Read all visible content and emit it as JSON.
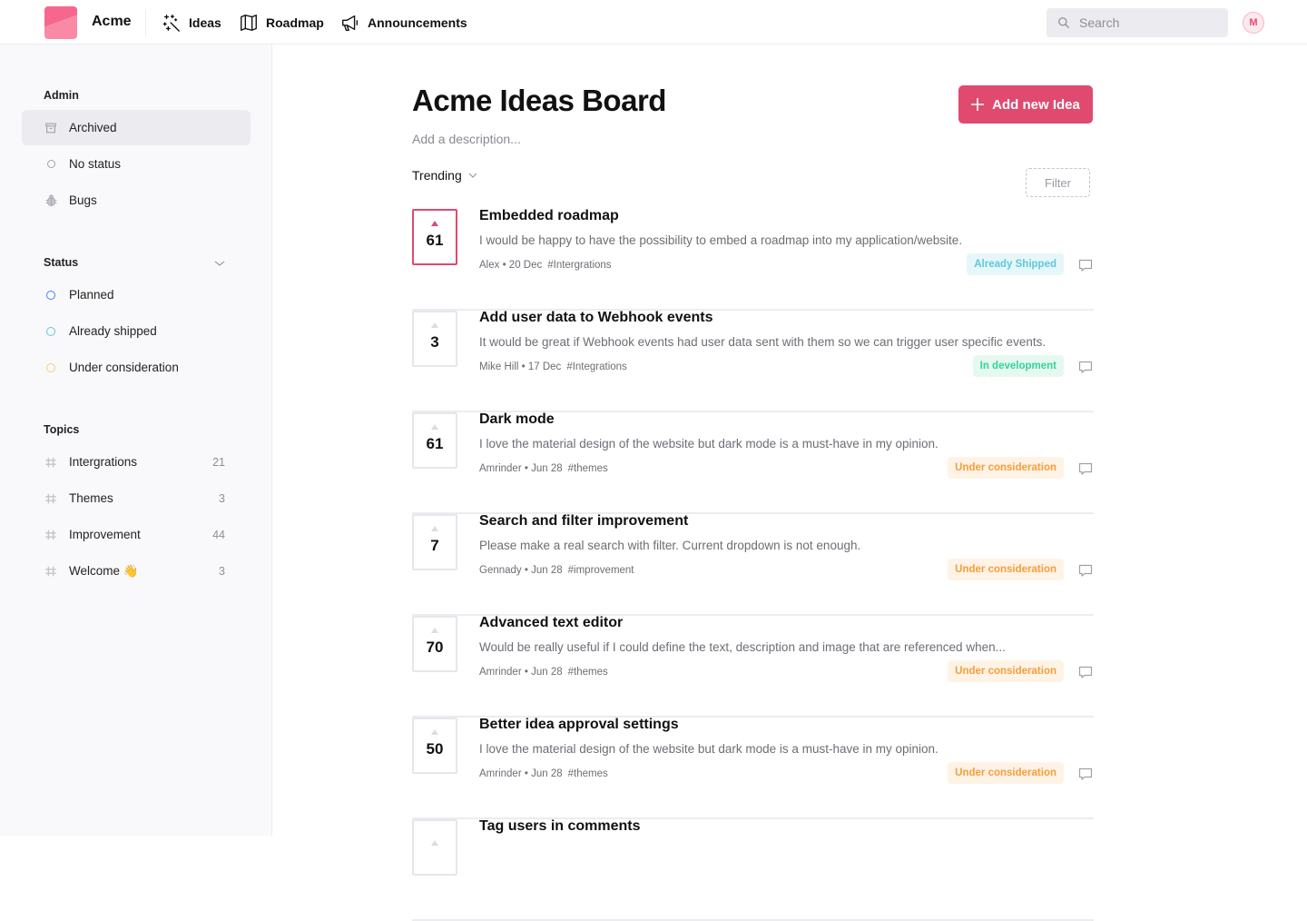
{
  "header": {
    "brand": "Acme",
    "nav": [
      {
        "label": "Ideas",
        "icon": "magic-wand-icon"
      },
      {
        "label": "Roadmap",
        "icon": "map-icon"
      },
      {
        "label": "Announcements",
        "icon": "megaphone-icon"
      }
    ],
    "search_placeholder": "Search",
    "avatar_initial": "M"
  },
  "sidebar": {
    "admin": {
      "title": "Admin",
      "items": [
        {
          "label": "Archived",
          "icon": "archive-icon",
          "active": true
        },
        {
          "label": "No status",
          "icon": "circle-icon"
        },
        {
          "label": "Bugs",
          "icon": "bug-icon"
        }
      ]
    },
    "status": {
      "title": "Status",
      "items": [
        {
          "label": "Planned",
          "color": "#3b82f6"
        },
        {
          "label": "Already shipped",
          "color": "#5ec8d8"
        },
        {
          "label": "Under consideration",
          "color": "#fbc97a"
        }
      ]
    },
    "topics": {
      "title": "Topics",
      "items": [
        {
          "label": "Intergrations",
          "count": "21"
        },
        {
          "label": "Themes",
          "count": "3"
        },
        {
          "label": "Improvement",
          "count": "44"
        },
        {
          "label": "Welcome 👋",
          "count": "3"
        }
      ]
    }
  },
  "main": {
    "title": "Acme Ideas Board",
    "description_placeholder": "Add a description...",
    "add_button": "Add new Idea",
    "sort_label": "Trending",
    "filter_label": "Filter",
    "ideas": [
      {
        "votes": "61",
        "title": "Embedded roadmap",
        "body": "I would be happy to have the possibility to embed a roadmap into my application/website.",
        "author": "Alex",
        "date": "20 Dec",
        "tag": "#Intergrations",
        "status": "Already Shipped",
        "status_color": "#5ec8d8",
        "status_bg": "#e6f7fa",
        "voted": true
      },
      {
        "votes": "3",
        "title": "Add user data to Webhook events",
        "body": "It would be great if Webhook events had user data sent with them so we can trigger user specific events.",
        "author": "Mike Hill",
        "date": "17 Dec",
        "tag": "#Integrations",
        "status": "In development",
        "status_color": "#34d399",
        "status_bg": "#e6f9f1"
      },
      {
        "votes": "61",
        "title": "Dark mode",
        "body": "I love the material design of the website but dark mode is a must-have in my opinion.",
        "author": "Amrinder",
        "date": "Jun 28",
        "tag": "#themes",
        "status": "Under consideration",
        "status_color": "#f59e3b",
        "status_bg": "#fff3e6"
      },
      {
        "votes": "7",
        "title": "Search and filter improvement",
        "body": "Please make a real search with filter.  Current dropdown is not enough.",
        "author": "Gennady",
        "date": "Jun 28",
        "tag": "#improvement",
        "status": "Under consideration",
        "status_color": "#f59e3b",
        "status_bg": "#fff3e6"
      },
      {
        "votes": "70",
        "title": "Advanced text editor",
        "body": "Would be really useful if I could define the text, description and image that are referenced when...",
        "author": "Amrinder",
        "date": "Jun 28",
        "tag": "#themes",
        "status": "Under consideration",
        "status_color": "#f59e3b",
        "status_bg": "#fff3e6"
      },
      {
        "votes": "50",
        "title": "Better idea approval settings",
        "body": "I love the material design of the website but dark mode is a must-have in my opinion.",
        "author": "Amrinder",
        "date": "Jun 28",
        "tag": "#themes",
        "status": "Under consideration",
        "status_color": "#f59e3b",
        "status_bg": "#fff3e6"
      },
      {
        "votes": "",
        "title": "Tag users in comments",
        "body": "",
        "author": "",
        "date": "",
        "tag": "",
        "status": "",
        "status_color": "",
        "status_bg": ""
      }
    ]
  }
}
